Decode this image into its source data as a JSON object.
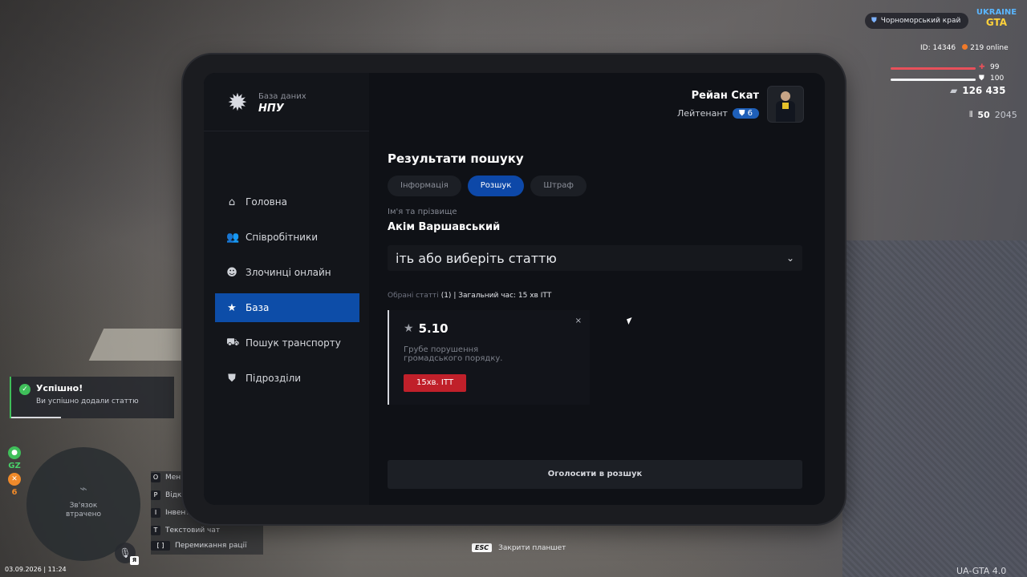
{
  "tablet": {
    "logo_sub": "База даних",
    "logo_main": "НПУ",
    "user_name": "Рейан Скат",
    "user_rank": "Лейтенант",
    "rank_level": "6",
    "nav": [
      {
        "label": "Головна",
        "icon": "home-icon"
      },
      {
        "label": "Співробітники",
        "icon": "people-icon"
      },
      {
        "label": "Злочинці онлайн",
        "icon": "mask-icon"
      },
      {
        "label": "База",
        "icon": "star-icon"
      },
      {
        "label": "Пошук транспорту",
        "icon": "car-icon"
      },
      {
        "label": "Підрозділи",
        "icon": "shield-icon"
      }
    ],
    "content": {
      "title": "Результати пошуку",
      "tabs": [
        "Інформація",
        "Розшук",
        "Штраф"
      ],
      "active_tab": "Розшук",
      "name_label": "Ім'я та прізвище",
      "full_name": "Акім Варшавський",
      "select_placeholder": "іть або виберіть статтю",
      "summary_label": "Обрані статті",
      "summary_count": "(1)",
      "summary_rest": "| Загальний час: 15 хв ІТТ",
      "article": {
        "code": "5.10",
        "description": "Грубе порушення громадського порядку.",
        "time": "15хв. ІТТ",
        "close": "×"
      },
      "submit_label": "Оголосити в розшук"
    }
  },
  "hud": {
    "region": "Чорноморський край",
    "logo_line1": "UKRAINE",
    "logo_line2": "GTA",
    "id": "ID: 14346",
    "online": "219 online",
    "health": "99",
    "armor": "100",
    "money": "126 435",
    "ammo_clip": "50",
    "ammo_total": "2045",
    "toast_title": "Успішно!",
    "toast_text": "Ви успішно додали статтю",
    "side_gz": "GZ",
    "side_num": "6",
    "minimap_text": "Зв'язок втрачено",
    "mic_key": "Я",
    "keys": [
      {
        "key": "O",
        "label": "Мен"
      },
      {
        "key": "P",
        "label": "Відк"
      },
      {
        "key": "I",
        "label": "Інвент"
      },
      {
        "key": "T",
        "label": "Текстовий чат"
      },
      {
        "key": "[ ]",
        "label": "Перемикання рації"
      }
    ],
    "datetime": "03.09.2026 | 11:24",
    "esc_key": "ESC",
    "esc_text": "Закрити планшет",
    "version": "UA-GTA 4.0"
  }
}
